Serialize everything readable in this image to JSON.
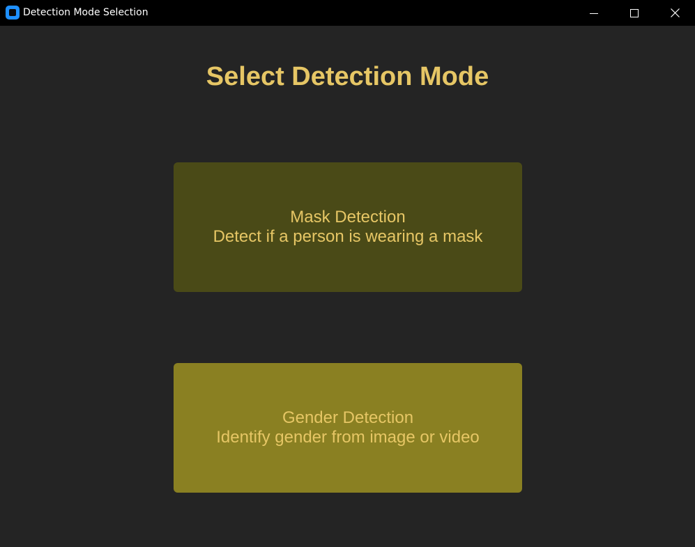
{
  "window": {
    "title": "Detection Mode Selection",
    "app_icon": "app-icon",
    "controls": {
      "minimize_icon": "minimize-icon",
      "maximize_icon": "maximize-icon",
      "close_icon": "close-icon"
    }
  },
  "main": {
    "heading": "Select Detection Mode",
    "modes": [
      {
        "title": "Mask Detection",
        "description": "Detect if a person is wearing a mask",
        "background": "#4a4a17"
      },
      {
        "title": "Gender Detection",
        "description": "Identify gender from image or video",
        "background": "#8a8022"
      }
    ]
  },
  "colors": {
    "background": "#242424",
    "titlebar": "#000000",
    "accent_text": "#e6c665"
  }
}
